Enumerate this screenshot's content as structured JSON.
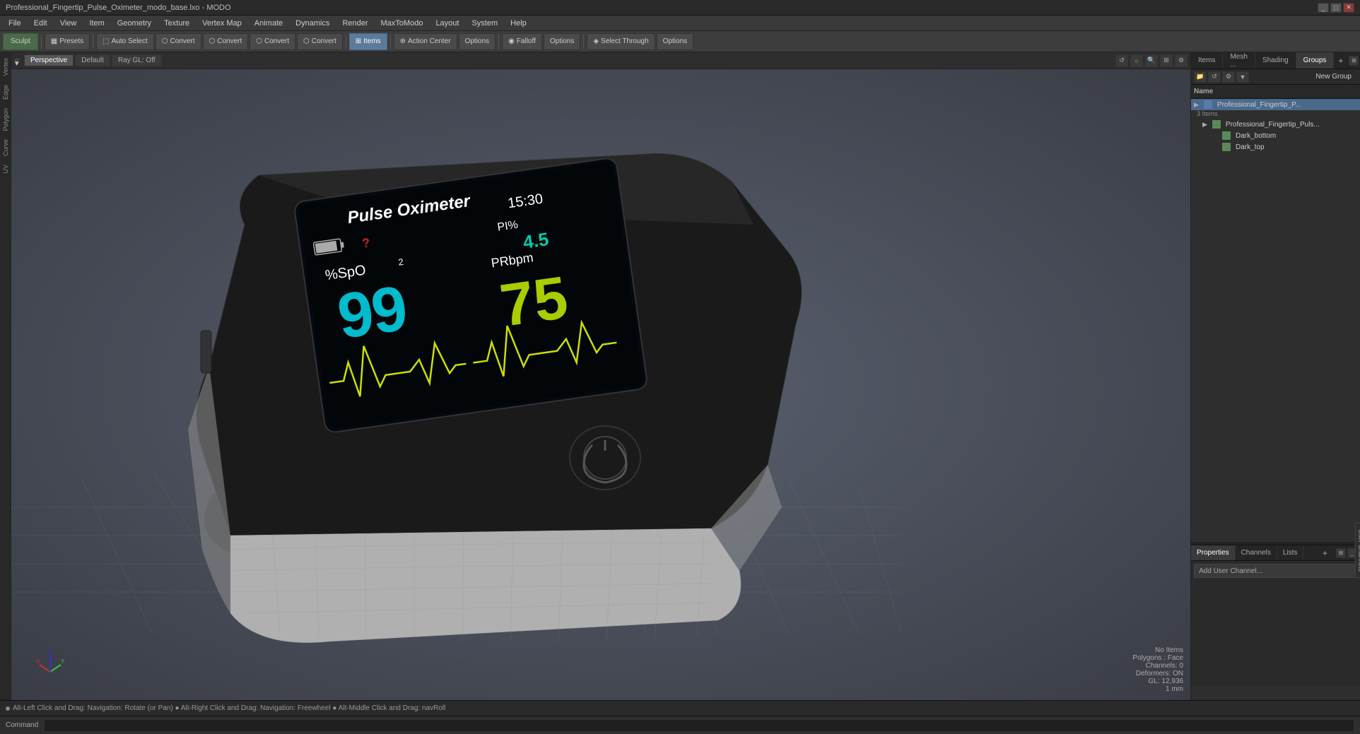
{
  "titlebar": {
    "title": "Professional_Fingertip_Pulse_Oximeter_modo_base.lxo - MODO",
    "controls": [
      "_",
      "□",
      "✕"
    ]
  },
  "menubar": {
    "items": [
      "File",
      "Edit",
      "View",
      "Item",
      "Geometry",
      "Texture",
      "Vertex Map",
      "Animate",
      "Dynamics",
      "Render",
      "MaxToModo",
      "Layout",
      "System",
      "Help"
    ]
  },
  "toolbar": {
    "sculpt_label": "Sculpt",
    "presets_label": "Presets",
    "auto_select_label": "Auto Select",
    "convert_labels": [
      "Convert",
      "Convert",
      "Convert",
      "Convert"
    ],
    "items_label": "Items",
    "action_center_label": "Action Center",
    "options_labels": [
      "Options",
      "Options",
      "Options"
    ],
    "falloff_label": "Falloff",
    "select_through_label": "Select Through"
  },
  "viewport": {
    "perspective_label": "Perspective",
    "default_label": "Default",
    "ray_gl_label": "Ray GL: Off",
    "tabs": [
      "Items",
      "Mesh ...",
      "Shading",
      "Groups"
    ]
  },
  "right_panel": {
    "tabs": [
      "Items",
      "Mesh ...",
      "Shading",
      "Groups"
    ],
    "groups_label": "Groups",
    "new_group_label": "New Group",
    "name_col": "Name",
    "items": [
      {
        "label": "Professional_Fingertip_P...",
        "level": 0,
        "type": "group",
        "count": "3 Items"
      },
      {
        "label": "Professional_Fingertip_Puls...",
        "level": 1,
        "type": "mesh"
      },
      {
        "label": "Dark_bottom",
        "level": 2,
        "type": "mesh"
      },
      {
        "label": "Dark_top",
        "level": 2,
        "type": "mesh"
      }
    ]
  },
  "properties_panel": {
    "tabs": [
      "Properties",
      "Channels",
      "Lists"
    ],
    "add_channel_label": "Add User Channel..."
  },
  "status_info": {
    "no_items": "No Items",
    "polygons": "Polygons : Face",
    "channels": "Channels: 0",
    "deformers": "Deformers: ON",
    "gl": "GL: 12,936",
    "scale": "1 mm"
  },
  "statusbar": {
    "text": "Alt-Left Click and Drag: Navigation: Rotate (or Pan)  ●  Alt-Right Click and Drag: Navigation: Freewheel  ●  Alt-Middle Click and Drag: navRoll"
  },
  "commandbar": {
    "label": "Command",
    "placeholder": ""
  },
  "left_labels": [
    "Vertex",
    "Edge",
    "Polygon",
    "Curve",
    "UV"
  ],
  "device": {
    "title": "Pulse Oximeter",
    "time": "15:30",
    "pi_label": "PI%",
    "pi_value": "4.5",
    "spo2_label": "%SpO₂",
    "spo2_value": "99",
    "pr_label": "PRbpm",
    "pr_value": "75",
    "battery_icon": "battery"
  }
}
